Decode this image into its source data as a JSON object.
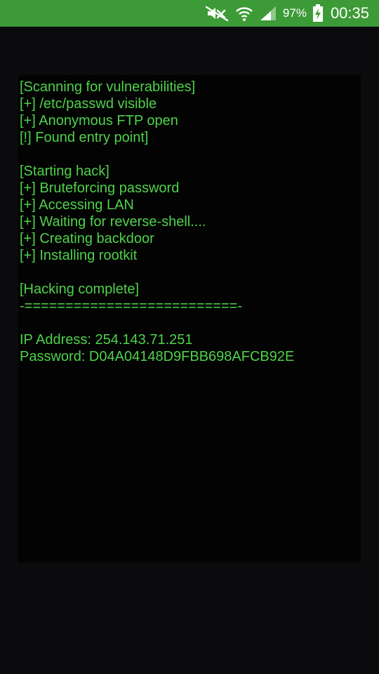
{
  "status_bar": {
    "icons": [
      "mute-icon",
      "wifi-icon",
      "signal-icon",
      "battery-charging-icon"
    ],
    "battery_percent": "97%",
    "time": "00:35",
    "color": "#3d9b37"
  },
  "terminal": {
    "text_color": "#4fd24a",
    "background": "#030303",
    "lines": [
      "[Scanning for vulnerabilities]",
      "[+] /etc/passwd visible",
      "[+] Anonymous FTP open",
      "[!] Found entry point]",
      "",
      "[Starting hack]",
      "[+] Bruteforcing password",
      "[+] Accessing LAN",
      "[+] Waiting for reverse-shell....",
      "[+] Creating backdoor",
      "[+] Installing rootkit",
      "",
      "[Hacking complete]",
      "-==========================-",
      "",
      "IP Address: 254.143.71.251",
      "Password: D04A04148D9FBB698AFCB92E"
    ]
  }
}
